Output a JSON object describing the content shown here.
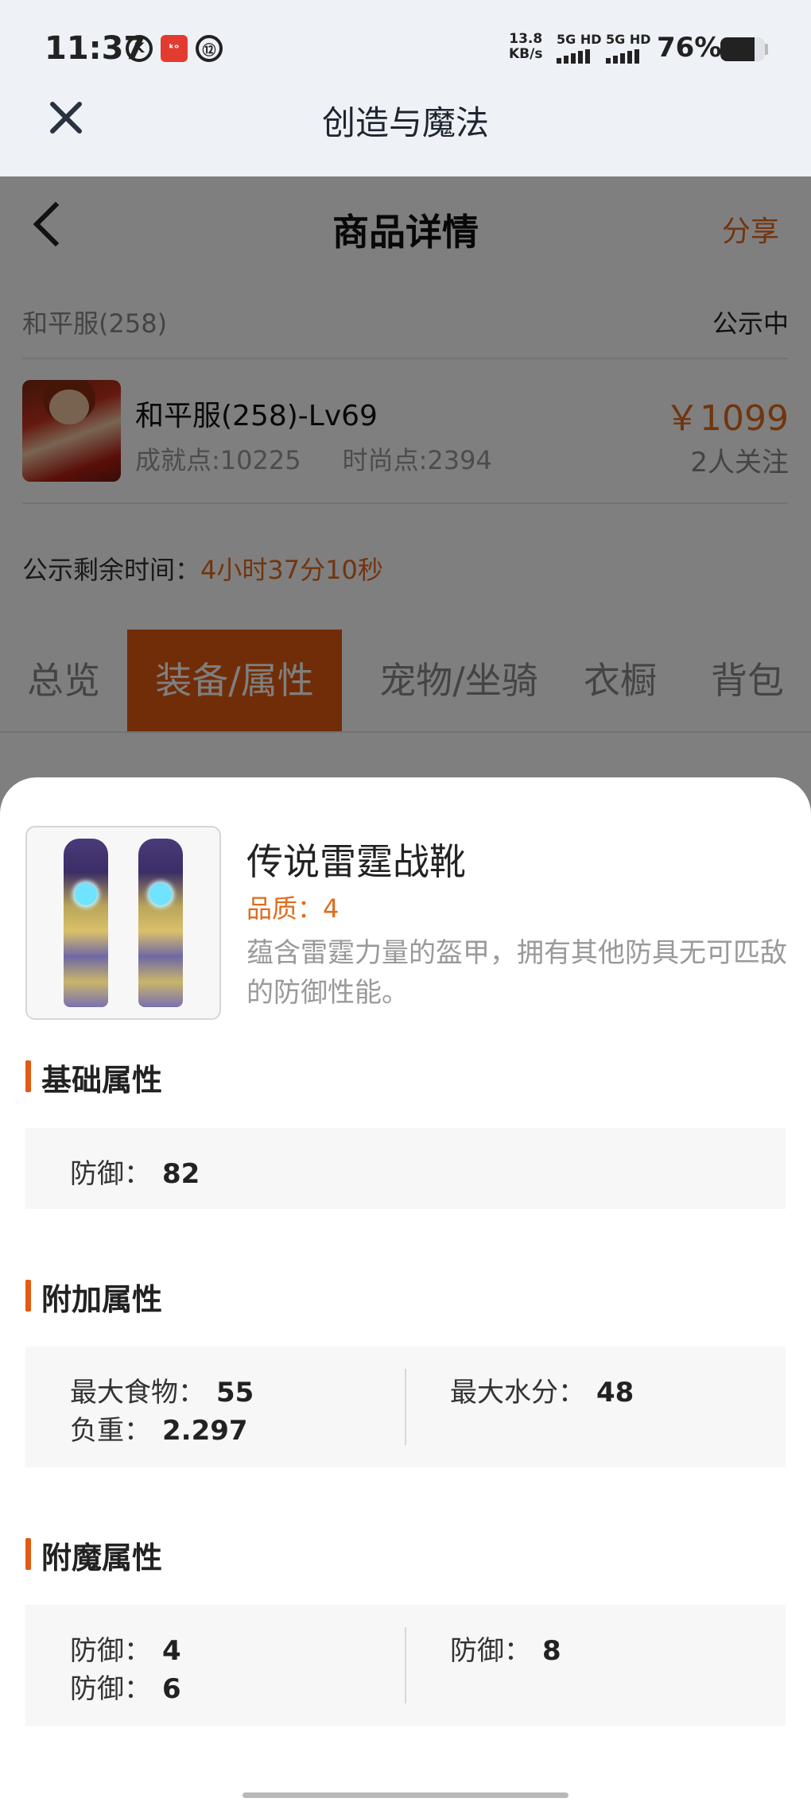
{
  "status_bar": {
    "time": "11:37",
    "indicators": [
      "K",
      "ᵏᵒ",
      "⑫"
    ],
    "net_speed": "13.8",
    "net_unit": "KB/s",
    "sim1": "5G HD",
    "sim2": "5G HD",
    "battery_pct": "76%",
    "battery_level": 0.76
  },
  "app_header": {
    "title": "创造与魔法"
  },
  "page": {
    "title": "商品详情",
    "share_label": "分享",
    "server": "和平服(258)",
    "status": "公示中",
    "account": {
      "name": "和平服(258)-Lv69",
      "achievement": "成就点:10225",
      "fashion": "时尚点:2394",
      "price": "￥1099",
      "followers": "2人关注"
    },
    "remaining_label": "公示剩余时间：",
    "remaining_value": "4小时37分10秒",
    "tabs": [
      "总览",
      "装备/属性",
      "宠物/坐骑",
      "衣橱",
      "背包"
    ],
    "active_tab": 1
  },
  "item": {
    "name": "传说雷霆战靴",
    "quality": "品质：4",
    "description": "蕴含雷霆力量的盔甲，拥有其他防具无可匹敌的防御性能。"
  },
  "sections": {
    "basic": {
      "title": "基础属性",
      "attrs": [
        {
          "label": "防御：",
          "value": "82"
        }
      ]
    },
    "extra": {
      "title": "附加属性",
      "left": [
        {
          "label": "最大食物：",
          "value": "55"
        },
        {
          "label": "负重：",
          "value": "2.297"
        }
      ],
      "right": [
        {
          "label": "最大水分：",
          "value": "48"
        }
      ]
    },
    "enchant": {
      "title": "附魔属性",
      "left": [
        {
          "label": "防御：",
          "value": "4"
        },
        {
          "label": "防御：",
          "value": "6"
        }
      ],
      "right": [
        {
          "label": "防御：",
          "value": "8"
        }
      ]
    }
  }
}
